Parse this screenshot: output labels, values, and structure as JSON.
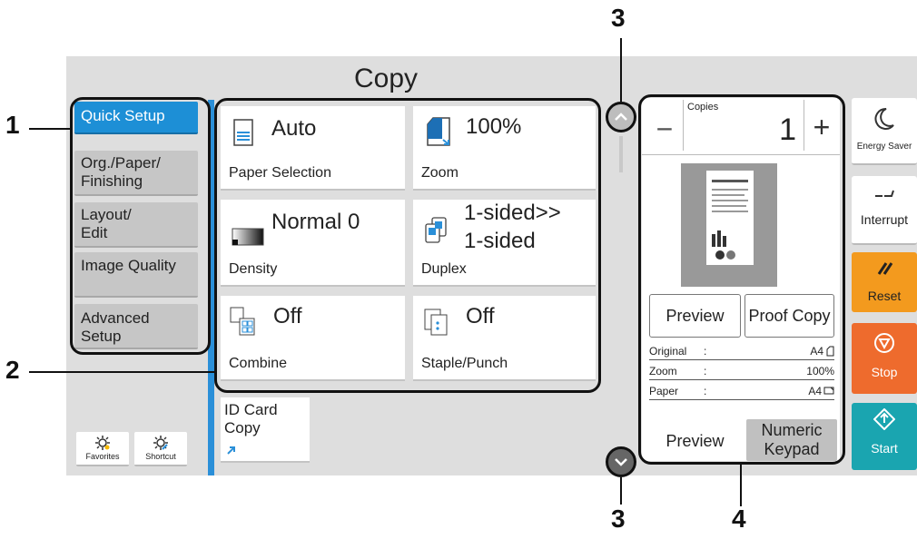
{
  "screen": {
    "title": "Copy"
  },
  "tabs": [
    {
      "label": "Quick Setup",
      "active": true
    },
    {
      "label": "Org./Paper/ Finishing"
    },
    {
      "label": "Layout/ Edit"
    },
    {
      "label": "Image Quality"
    },
    {
      "label": "Advanced Setup"
    }
  ],
  "tiles": {
    "paper": {
      "value": "Auto",
      "label": "Paper Selection"
    },
    "zoom": {
      "value": "100%",
      "label": "Zoom"
    },
    "density": {
      "value": "Normal 0",
      "label": "Density"
    },
    "duplex": {
      "value": "1-sided>>",
      "value2": "1-sided",
      "label": "Duplex"
    },
    "combine": {
      "value": "Off",
      "label": "Combine"
    },
    "staple": {
      "value": "Off",
      "label": "Staple/Punch"
    }
  },
  "id_card": {
    "line1": "ID Card",
    "line2": "Copy"
  },
  "bottom_left": {
    "favorites": "Favorites",
    "shortcut": "Shortcut"
  },
  "copies": {
    "label": "Copies",
    "value": "1",
    "minus": "−",
    "plus": "+"
  },
  "preview_panel": {
    "preview_btn": "Preview",
    "proof_btn": "Proof Copy",
    "rows": [
      {
        "name": "Original",
        "sep": ":",
        "value": "A4"
      },
      {
        "name": "Zoom",
        "sep": ":",
        "value": "100%"
      },
      {
        "name": "Paper",
        "sep": ":",
        "value": "A4"
      }
    ],
    "tab_preview": "Preview",
    "tab_keypad_1": "Numeric",
    "tab_keypad_2": "Keypad"
  },
  "side_buttons": {
    "energy": "Energy Saver",
    "interrupt": "Interrupt",
    "reset": "Reset",
    "stop": "Stop",
    "start": "Start"
  },
  "colors": {
    "accent": "#1d8fd6",
    "reset": "#f39a1e",
    "stop": "#ee6b2d",
    "start": "#1aa5b0"
  },
  "callouts": {
    "c1": "1",
    "c2": "2",
    "c3_top": "3",
    "c3_bottom": "3",
    "c4": "4"
  }
}
